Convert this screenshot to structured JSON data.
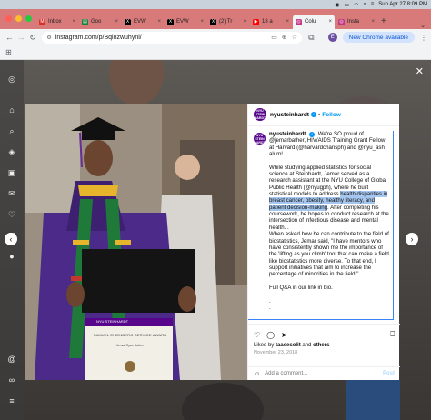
{
  "menubar": {
    "datetime": "Sun Apr 27  8:09 PM"
  },
  "tabs": [
    {
      "label": "Inbox",
      "color": "#d93025",
      "glyph": "M",
      "active": false
    },
    {
      "label": "Goo",
      "color": "#188038",
      "glyph": "▤",
      "active": false
    },
    {
      "label": "EVW",
      "color": "#000000",
      "glyph": "X",
      "active": false
    },
    {
      "label": "EVW",
      "color": "#000000",
      "glyph": "X",
      "active": false
    },
    {
      "label": "(2) Tr",
      "color": "#000000",
      "glyph": "X",
      "active": false
    },
    {
      "label": "18 a",
      "color": "#ff0000",
      "glyph": "▶",
      "active": false
    },
    {
      "label": "Colu",
      "color": "#c13584",
      "glyph": "◎",
      "active": true
    },
    {
      "label": "Insta",
      "color": "#c13584",
      "glyph": "◎",
      "active": false
    }
  ],
  "toolbar": {
    "url": "instagram.com/p/Bqi8zwuhynl/",
    "avatar_letter": "E",
    "update_label": "New Chrome available"
  },
  "post": {
    "account": "nyusteinhardt",
    "follow_label": "Follow",
    "logo_text": "NYU STEIN HARDT",
    "caption_before": "We're SO proud of @jemarbather, HIV/AIDS Training Grant Fellow at Harvard (@harvardchansph) and @nyu_ash alum!\n\nWhile studying applied statistics for social science at Steinhardt, Jemar served as a research assistant at the NYU College of Global Public Health (@nyugph), where he built statistical models to address ",
    "caption_highlight": "health disparities in breast cancer, obesity, healthy literacy, and patient decision-making",
    "caption_after": ". After completing his coursework, he hopes to conduct research at the intersection of infectious disease and mental health. .\nWhen asked how he can contribute to the field of biostatistics, Jemar said, \"I have mentors who have consistently shown me the importance of the 'lifting as you climb' tool that can make a field like biostatistics more diverse. To that end, I support initiatives that aim to increase the percentage of minorities in the field.\"\n\nFull Q&A in our link in bio.\n.\n.\n.",
    "liked_by_prefix": "Liked by ",
    "liked_by_user": "taaeesolit",
    "liked_by_suffix": " and ",
    "liked_by_others": "others",
    "date": "November 23, 2018",
    "comment_placeholder": "Add a comment...",
    "post_label": "Post"
  },
  "certificate": {
    "header": "NYU STEINHARDT",
    "title": "SAMUEL EISENBERG SERVICE AWARD",
    "name": "Jemar Ryan Bather"
  },
  "colors": {
    "instagram_blue": "#0095f6",
    "nyu_purple": "#57068c",
    "tabstrip": "#d97a7a"
  }
}
